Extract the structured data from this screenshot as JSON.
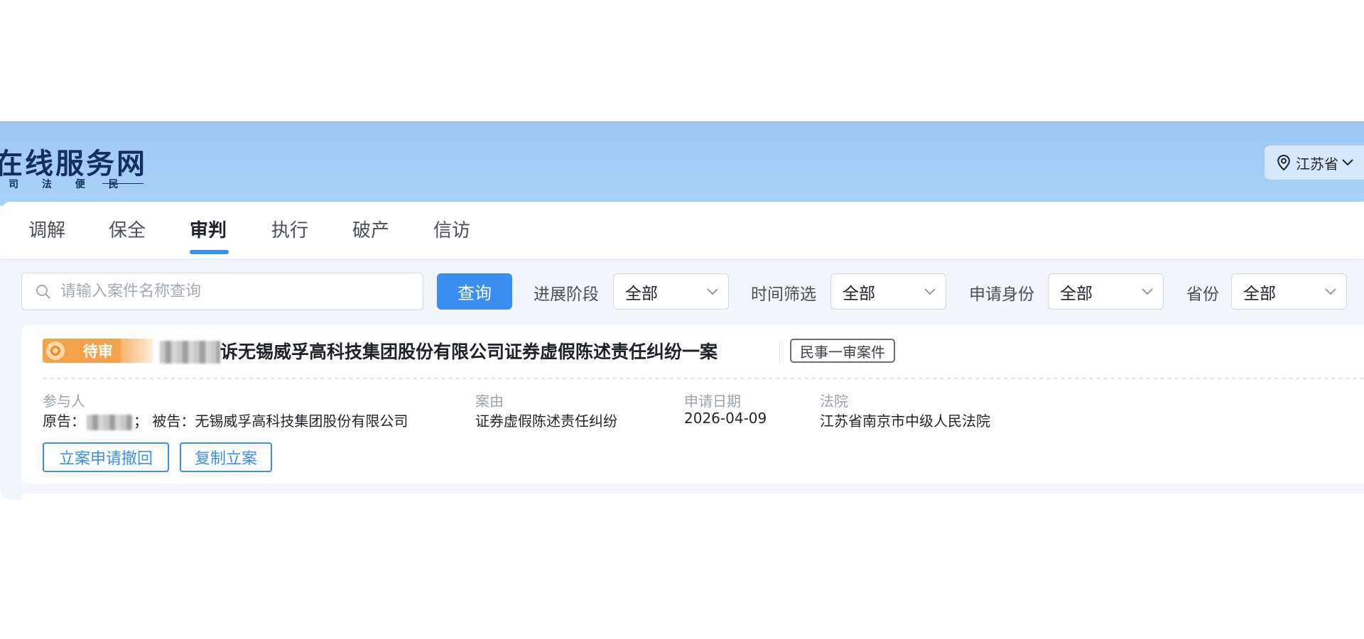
{
  "header": {
    "site_title": "在线服务网",
    "site_subtitle": "司 法 便 民",
    "region_label": "江苏省"
  },
  "tabs": [
    {
      "label": "调解"
    },
    {
      "label": "保全"
    },
    {
      "label": "审判",
      "active": true
    },
    {
      "label": "执行"
    },
    {
      "label": "破产"
    },
    {
      "label": "信访"
    }
  ],
  "filters": {
    "search_placeholder": "请输入案件名称查询",
    "query_button": "查询",
    "stage_label": "进展阶段",
    "stage_value": "全部",
    "time_label": "时间筛选",
    "time_value": "全部",
    "identity_label": "申请身份",
    "identity_value": "全部",
    "province_label": "省份",
    "province_value": "全部"
  },
  "case": {
    "status": "待审",
    "title": "诉无锡威孚高科技集团股份有限公司证券虚假陈述责任纠纷一案",
    "type_tag": "民事一审案件",
    "participants_label": "参与人",
    "plaintiff_prefix": "原告：",
    "defendant_text": "；  被告：无锡威孚高科技集团股份有限公司",
    "cause_label": "案由",
    "cause_value": "证券虚假陈述责任纠纷",
    "date_label": "申请日期",
    "date_value": "2026-04-09",
    "court_label": "法院",
    "court_value": "江苏省南京市中级人民法院",
    "withdraw_button": "立案申请撤回",
    "copy_button": "复制立案"
  },
  "colors": {
    "accent": "#3a8ef0",
    "header_bg": "#a9d1f8",
    "status_badge": "#f4a24a"
  }
}
